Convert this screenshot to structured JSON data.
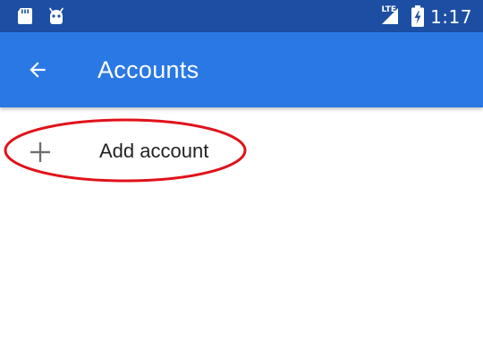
{
  "status_bar": {
    "network_type": "LTE",
    "time": "1:17",
    "icons": [
      "sd-card-icon",
      "android-debug-icon",
      "signal-icon",
      "battery-charging-icon"
    ]
  },
  "app_bar": {
    "back_icon": "arrow-back-icon",
    "title": "Accounts",
    "color": "#2a78e4"
  },
  "accounts_list": {
    "add_account_label": "Add account",
    "add_icon": "plus-icon"
  },
  "annotation": {
    "highlight_color": "#e0121a",
    "target": "add-account-row"
  }
}
